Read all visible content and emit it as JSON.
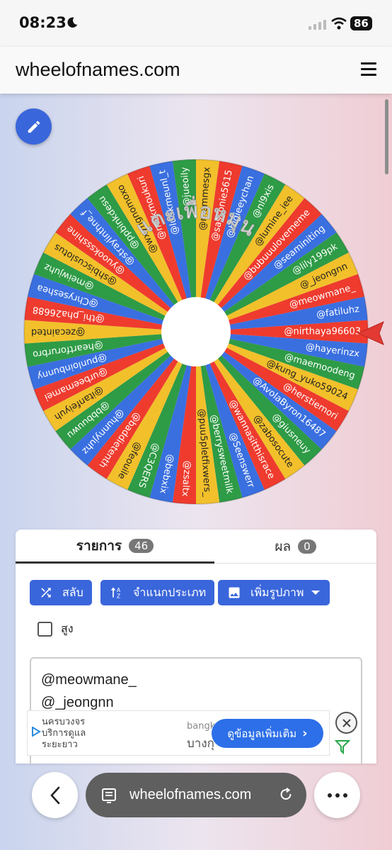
{
  "status_bar": {
    "time": "08:23",
    "battery": "86"
  },
  "header": {
    "site": "wheelofnames.com"
  },
  "wheel": {
    "spin_text": "แตะเพื่อหมุน",
    "colors": [
      "#ee3b2e",
      "#3a6fe0",
      "#2e9b46",
      "#f2c02b"
    ],
    "entries": [
      "@nirthaya96603",
      "@hayerinzx",
      "@maemoodeng",
      "@kung_yuko59024",
      "@herstiemori",
      "@AvolaByron16487",
      "@giusneuy",
      "@zabosocute",
      "@wannasitthisrace",
      "@Seenswerr",
      "@berrysweetmilk",
      "@puu5pletfixwers_",
      "@zsaltx",
      "@bebxix",
      "@C3QERS",
      "@feouile",
      "@baddietenth",
      "@hunnyjuhz",
      "@bbbuuwu",
      "@itanfeiyuh",
      "@urbeemamei",
      "@punloinbunny",
      "@heartforurbro",
      "@zecainted",
      "@thi_pha26688",
      "@Chryseshea",
      "@meiwjuhz",
      "@shbiscuslotus",
      "@yuookssshine",
      "@straylinthne_f",
      "@ppbinkdesu",
      "@wxyngnomoxo",
      "@mukmoukuri",
      "@luukmeunl_t",
      "@jueoily",
      "@memmesgx",
      "@sassonie5615",
      "@bigieeychan",
      "@nl9xis",
      "@lumine_iee",
      "@bubuuulovememe",
      "@seaminiting",
      "@lily199pk",
      "@_jeongnn",
      "@meowmane_",
      "@fatiluhz"
    ]
  },
  "card": {
    "tab_list_label": "รายการ",
    "tab_list_count": "46",
    "tab_results_label": "ผล",
    "tab_results_count": "0",
    "shuffle_label": "สลับ",
    "sort_label": "จำแนกประเภท",
    "add_image_label": "เพิ่มรูปภาพ",
    "advanced_label": "สูง",
    "text_lines": [
      "@meowmane_",
      "@_jeongnn"
    ]
  },
  "ad": {
    "left_line1": "นครบวงจร",
    "left_line2": "บริการดูแล",
    "left_line3": "ระยะยาว",
    "mid_top": "bangk",
    "mid_bottom": "บางกุ",
    "cta": "ดูข้อมูลเพิ่มเติม"
  },
  "browser": {
    "url": "wheelofnames.com"
  }
}
